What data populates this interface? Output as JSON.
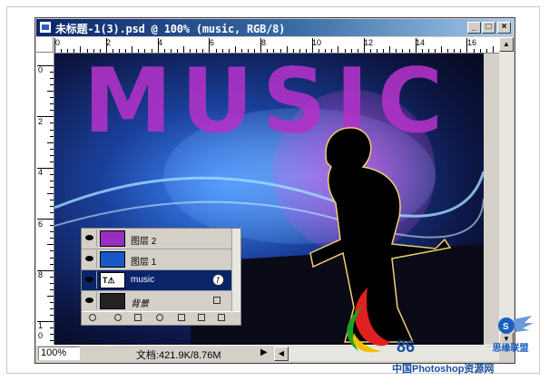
{
  "window": {
    "title": "未标题-1(3).psd @ 100% (music, RGB/8)",
    "buttons": {
      "minimize": "_",
      "maximize": "□",
      "close": "×"
    }
  },
  "ruler": {
    "top": [
      "0",
      "2",
      "4",
      "6",
      "8",
      "10",
      "12",
      "14",
      "16"
    ],
    "left": [
      "0",
      "2",
      "4",
      "6",
      "8",
      "1",
      "0"
    ]
  },
  "canvas": {
    "headline": "MUSIC"
  },
  "layers": [
    {
      "name": "图层 2",
      "selected": false,
      "thumb": "#9a2fbf"
    },
    {
      "name": "图层 1",
      "selected": false,
      "thumb": "#1a57c8"
    },
    {
      "name": "music",
      "selected": true,
      "thumb": "#ffffff"
    },
    {
      "name": "背景",
      "selected": false,
      "thumb": "#222222"
    }
  ],
  "status": {
    "zoom": "100%",
    "doc": "文档:421.9K/8.76M"
  },
  "watermark": {
    "logo_text": "86",
    "site_cn": "中国Photoshop资源网",
    "site_right": "思缘联盟"
  }
}
